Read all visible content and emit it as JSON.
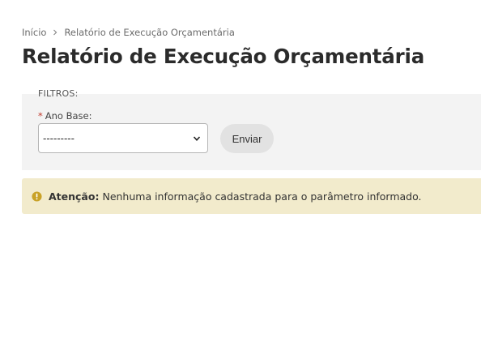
{
  "breadcrumb": {
    "home": "Início",
    "current": "Relatório de Execução Orçamentária"
  },
  "page_title": "Relatório de Execução Orçamentária",
  "filters": {
    "section_label": "FILTROS:",
    "ano_base": {
      "required_mark": "*",
      "label": "Ano Base:",
      "selected_value": "---------"
    },
    "submit_label": "Enviar"
  },
  "alert": {
    "icon": "warning-circle-icon",
    "title": "Atenção:",
    "message": "Nenhuma informação cadastrada para o parâmetro informado.",
    "background": "#f2ebcc",
    "icon_color": "#c9a227"
  }
}
